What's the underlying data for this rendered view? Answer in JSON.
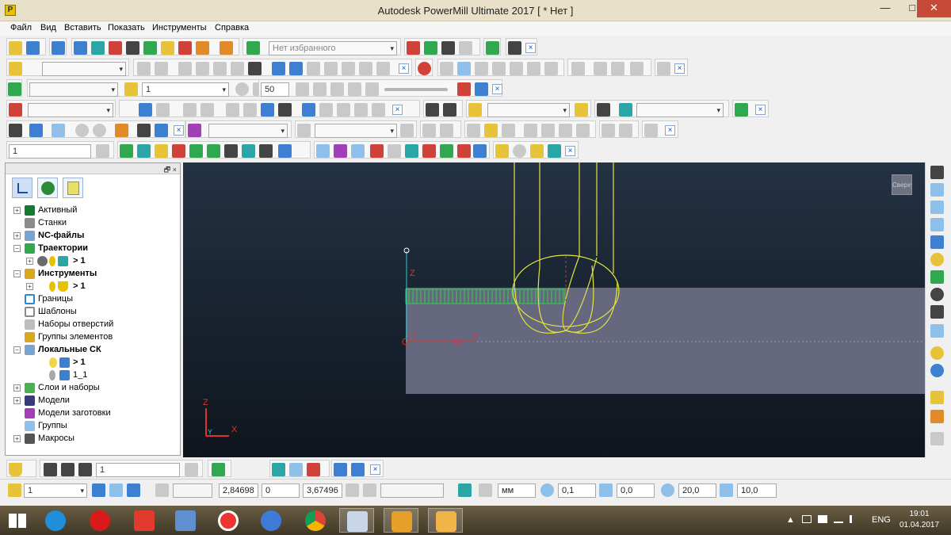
{
  "window": {
    "title": "Autodesk PowerMill Ultimate 2017   [  * Нет ]",
    "app_icon": "P",
    "controls": {
      "minimize": "—",
      "maximize": "□",
      "close": "✕"
    }
  },
  "menu": [
    "Файл",
    "Вид",
    "Вставить",
    "Показать",
    "Инструменты",
    "Справка"
  ],
  "toolbars": {
    "favorites_placeholder": "Нет избранного",
    "toolpath_combo_value": "1",
    "tool_combo_value": "1",
    "step_value": "50",
    "close_glyph": "×",
    "dropdown_glyph": "▾"
  },
  "explorer": {
    "pin": "🗗 ×",
    "items": [
      {
        "label": "Активный",
        "bold": false,
        "icon": "active-icon"
      },
      {
        "label": "Станки",
        "bold": false,
        "icon": "machine-icon"
      },
      {
        "label": "NC-файлы",
        "bold": true,
        "icon": "nc-files-icon"
      },
      {
        "label": "Траектории",
        "bold": true,
        "icon": "toolpaths-icon"
      },
      {
        "label": "> 1",
        "bold": true,
        "icon": "toolpath-icon"
      },
      {
        "label": "Инструменты",
        "bold": true,
        "icon": "tools-icon"
      },
      {
        "label": "> 1",
        "bold": true,
        "icon": "tool-icon"
      },
      {
        "label": "Границы",
        "bold": false,
        "icon": "boundaries-icon"
      },
      {
        "label": "Шаблоны",
        "bold": false,
        "icon": "patterns-icon"
      },
      {
        "label": "Наборы отверстий",
        "bold": false,
        "icon": "featuresets-icon"
      },
      {
        "label": "Группы элементов",
        "bold": false,
        "icon": "feature-groups-icon"
      },
      {
        "label": "Локальные СК",
        "bold": true,
        "icon": "workplanes-icon"
      },
      {
        "label": "> 1",
        "bold": true,
        "icon": "workplane-icon"
      },
      {
        "label": "1_1",
        "bold": false,
        "icon": "workplane-icon"
      },
      {
        "label": "Слои и наборы",
        "bold": false,
        "icon": "layers-icon"
      },
      {
        "label": "Модели",
        "bold": false,
        "icon": "models-icon"
      },
      {
        "label": "Модели заготовки",
        "bold": false,
        "icon": "stock-models-icon"
      },
      {
        "label": "Группы",
        "bold": false,
        "icon": "groups-icon"
      },
      {
        "label": "Макросы",
        "bold": false,
        "icon": "macros-icon"
      }
    ]
  },
  "viewport": {
    "view_cube_label": "Сверху",
    "axis_x": "X",
    "axis_y": "Y",
    "axis_z": "Z"
  },
  "bottom_toolbar": {
    "tool_combo_value": "1"
  },
  "status": {
    "workplane_value": "1",
    "x": "2,84698",
    "y": "0",
    "z": "3,67496",
    "units": "мм",
    "tolerance": "0,1",
    "thickness": "0,0",
    "diameter": "20,0",
    "stepdown": "10,0"
  },
  "taskbar": {
    "lang": "ENG",
    "time": "19:01",
    "date": "01.04.2017",
    "tray_arrow": "▲",
    "apps": [
      "start",
      "ie",
      "opera",
      "yandex-search",
      "calculator",
      "yandex-browser",
      "media",
      "chrome",
      "keyboard",
      "powermill-1",
      "powermill-2"
    ]
  },
  "colors": {
    "wire": "#e4e43c",
    "stock": "#66687f",
    "axis_red": "#d33",
    "axis_cyan": "#2cc",
    "toolpath": "#2fd04f"
  }
}
